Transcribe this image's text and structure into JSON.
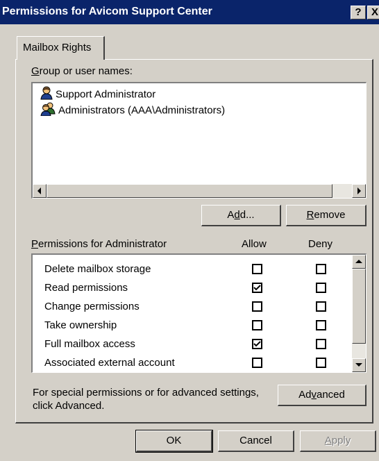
{
  "window": {
    "title": "Permissions for Avicom Support Center",
    "help_label": "?",
    "close_label": "X"
  },
  "tab": {
    "label": "Mailbox Rights"
  },
  "group_section": {
    "label_prefix": "",
    "label_accel": "G",
    "label_rest": "roup or user names:",
    "items": [
      {
        "name": "Support Administrator",
        "icon": "single-user-icon"
      },
      {
        "name": "Administrators (AAA\\Administrators)",
        "icon": "user-group-icon"
      }
    ]
  },
  "buttons": {
    "add": {
      "pre": "A",
      "accel": "d",
      "post": "d..."
    },
    "remove": {
      "pre": "",
      "accel": "R",
      "post": "emove"
    },
    "advanced": {
      "pre": "Ad",
      "accel": "v",
      "post": "anced"
    },
    "ok": "OK",
    "cancel": "Cancel",
    "apply": {
      "pre": "",
      "accel": "A",
      "post": "pply"
    }
  },
  "permissions_section": {
    "label_accel": "P",
    "label_rest": "ermissions for Administrator",
    "allow_header": "Allow",
    "deny_header": "Deny",
    "rows": [
      {
        "name": "Delete mailbox storage",
        "allow": false,
        "deny": false
      },
      {
        "name": "Read permissions",
        "allow": true,
        "deny": false
      },
      {
        "name": "Change permissions",
        "allow": false,
        "deny": false
      },
      {
        "name": "Take ownership",
        "allow": false,
        "deny": false
      },
      {
        "name": "Full mailbox access",
        "allow": true,
        "deny": false
      },
      {
        "name": "Associated external account",
        "allow": false,
        "deny": false
      }
    ]
  },
  "advanced_note": {
    "line1": "For special permissions or for advanced settings,",
    "line2": "click Advanced."
  },
  "colors": {
    "titlebar": "#0a246a",
    "face": "#d4d0c8"
  }
}
